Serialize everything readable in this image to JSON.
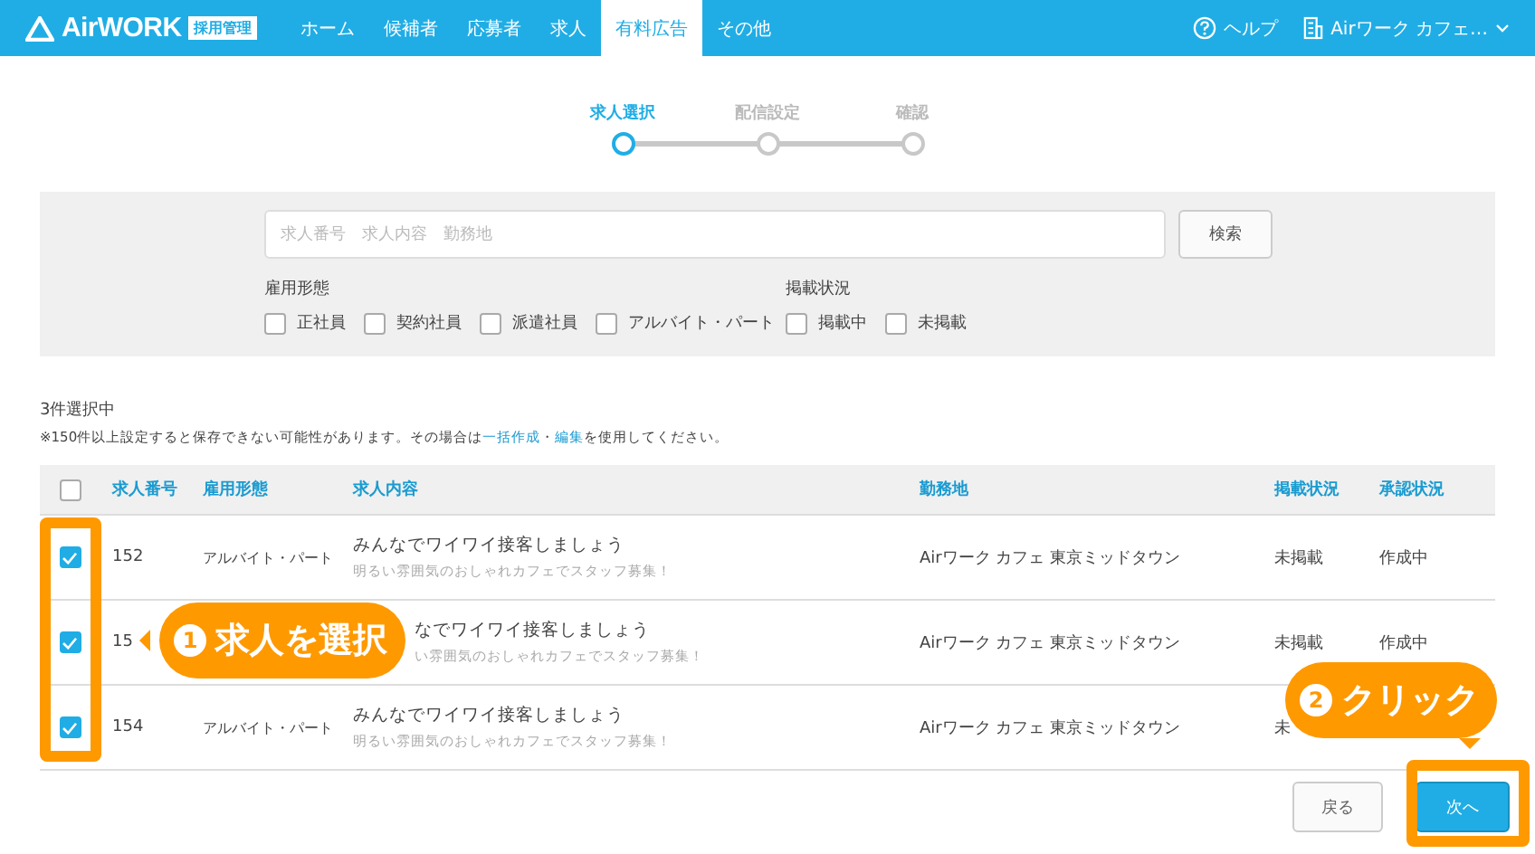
{
  "header": {
    "logo": "AirWORK",
    "badge": "採用管理",
    "nav": [
      {
        "label": "ホーム",
        "selected": false
      },
      {
        "label": "候補者",
        "selected": false
      },
      {
        "label": "応募者",
        "selected": false
      },
      {
        "label": "求人",
        "selected": false
      },
      {
        "label": "有料広告",
        "selected": true
      },
      {
        "label": "その他",
        "selected": false
      }
    ],
    "help": "ヘルプ",
    "account": "Airワーク カフェ…"
  },
  "stepper": {
    "steps": [
      {
        "label": "求人選択",
        "selected": true
      },
      {
        "label": "配信設定",
        "selected": false
      },
      {
        "label": "確認",
        "selected": false
      }
    ]
  },
  "search": {
    "placeholder": "求人番号　求人内容　勤務地",
    "button": "検索",
    "groups": [
      {
        "label": "雇用形態",
        "options": [
          {
            "label": "正社員",
            "checked": false
          },
          {
            "label": "契約社員",
            "checked": false
          },
          {
            "label": "派遣社員",
            "checked": false
          },
          {
            "label": "アルバイト・パート",
            "checked": false
          }
        ]
      },
      {
        "label": "掲載状況",
        "options": [
          {
            "label": "掲載中",
            "checked": false
          },
          {
            "label": "未掲載",
            "checked": false
          }
        ]
      }
    ]
  },
  "selection_count": "3件選択中",
  "note": {
    "before": "※150件以上設定すると保存できない可能性があります。その場合は",
    "link_1": "一括作成",
    "separator": "・",
    "link_2": "編集",
    "after": "を使用してください。"
  },
  "table": {
    "header_checked": false,
    "columns": [
      "求人番号",
      "雇用形態",
      "求人内容",
      "勤務地",
      "掲載状況",
      "承認状況"
    ],
    "rows": [
      {
        "checked": true,
        "covered": false,
        "number": "152",
        "type": "アルバイト・パート",
        "title": "みんなでワイワイ接客しましょう",
        "subtitle": "明るい雰囲気のおしゃれカフェでスタッフ募集！",
        "location": "Airワーク カフェ 東京ミッドタウン",
        "status": "未掲載",
        "approval": "作成中"
      },
      {
        "checked": true,
        "covered": true,
        "number": "15",
        "title": "なでワイワイ接客しましょう",
        "subtitle": "い雰囲気のおしゃれカフェでスタッフ募集！",
        "location": "Airワーク カフェ 東京ミッドタウン",
        "status": "未掲載",
        "approval": "作成中"
      },
      {
        "checked": true,
        "covered": false,
        "number": "154",
        "type": "アルバイト・パート",
        "title": "みんなでワイワイ接客しましょう",
        "subtitle": "明るい雰囲気のおしゃれカフェでスタッフ募集！",
        "location": "Airワーク カフェ 東京ミッドタウン",
        "status": "未"
      }
    ]
  },
  "buttons": {
    "back": "戻る",
    "next": "次へ"
  },
  "callouts": [
    {
      "number": "1",
      "text": "求人を選択"
    },
    {
      "number": "2",
      "text": "クリック"
    }
  ]
}
